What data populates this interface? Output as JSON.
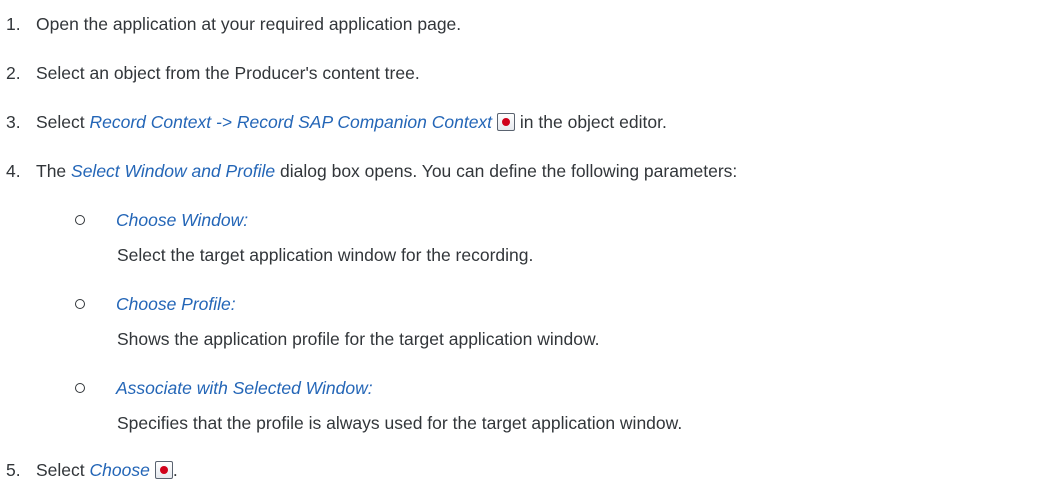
{
  "steps": [
    {
      "number": "1.",
      "text": "Open the application at your required application page."
    },
    {
      "number": "2.",
      "text": "Select an object from the Producer's content tree."
    },
    {
      "number": "3.",
      "pre": "Select ",
      "link": "Record Context -> Record SAP Companion Context",
      "post": " in the object editor."
    },
    {
      "number": "4.",
      "pre": "The ",
      "link": "Select Window and Profile",
      "post": " dialog box opens. You can define the following parameters:"
    },
    {
      "number": "5.",
      "pre": "Select ",
      "link": "Choose",
      "post": "."
    }
  ],
  "parameters": [
    {
      "term": "Choose Window:",
      "description": "Select the target application window for the recording."
    },
    {
      "term": "Choose Profile:",
      "description": "Shows the application profile for the target application window."
    },
    {
      "term": "Associate with Selected Window:",
      "description": "Specifies that the profile is always used for the target application window."
    }
  ],
  "icons": {
    "record": "record-icon",
    "record_color": "#d0021b",
    "link_color": "#2466b7"
  }
}
